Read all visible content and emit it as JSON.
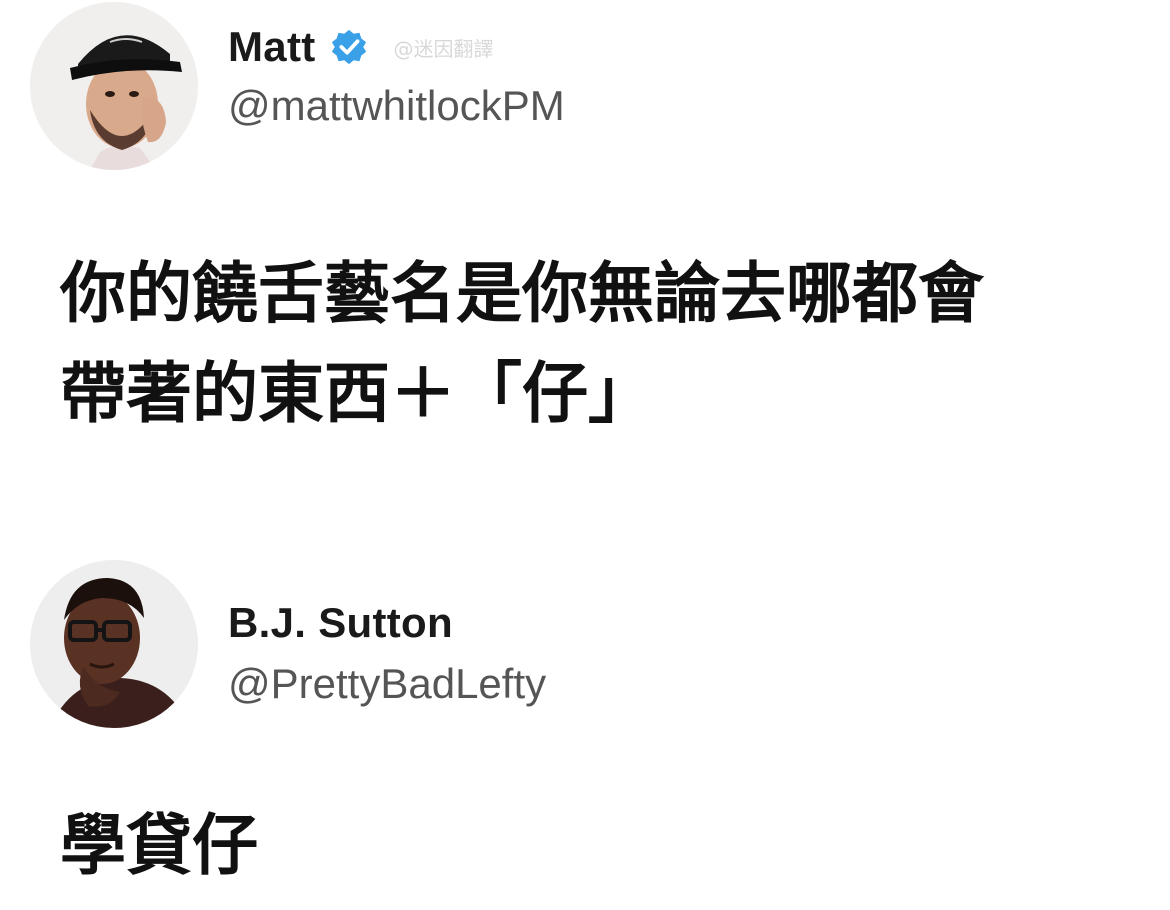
{
  "posts": [
    {
      "author": {
        "display_name": "Matt",
        "handle": "@mattwhitlockPM",
        "verified": true,
        "avatar_icon": "man-in-black-cap-avatar"
      },
      "watermark": "@迷因翻譯",
      "body_lines": [
        "你的饒舌藝名是你無論去哪都會",
        "帶著的東西＋「仔」"
      ]
    },
    {
      "author": {
        "display_name": "B.J. Sutton",
        "handle": "@PrettyBadLefty",
        "verified": false,
        "avatar_icon": "man-with-glasses-avatar"
      },
      "body_lines": [
        "學貸仔"
      ]
    }
  ],
  "colors": {
    "verified_badge": "#3aa0e8",
    "handle_text": "#555555",
    "body_text": "#111111"
  }
}
